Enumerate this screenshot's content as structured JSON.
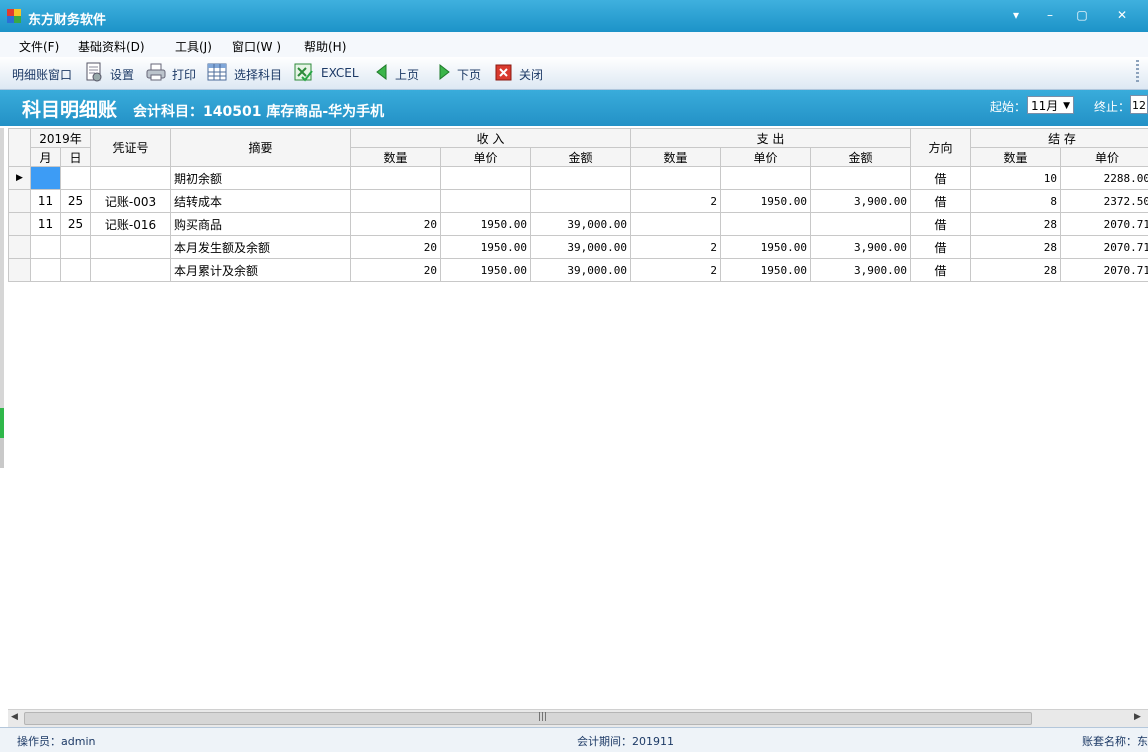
{
  "window": {
    "title": "东方财务软件",
    "controls": [
      "▾",
      "–",
      "▢",
      "✕"
    ]
  },
  "menu": [
    "文件(F)",
    "基础资料(D)",
    "工具(J)",
    "窗口(W )",
    "帮助(H)"
  ],
  "toolbar": {
    "window_label": "明细账窗口",
    "settings": "设置",
    "print": "打印",
    "select_subject": "选择科目",
    "excel": "EXCEL",
    "prev": "上页",
    "next": "下页",
    "close": "关闭"
  },
  "header": {
    "title": "科目明细账",
    "subject": "会计科目：140501 库存商品-华为手机",
    "start_label": "起始：",
    "start_value": "11月",
    "end_label": "终止：",
    "end_value": "12"
  },
  "grid": {
    "year": "2019年",
    "month": "月",
    "day": "日",
    "voucher": "凭证号",
    "summary": "摘要",
    "income": "收  入",
    "expense": "支  出",
    "direction": "方向",
    "balance": "结  存",
    "qty": "数量",
    "price": "单价",
    "amount": "金额",
    "rows": [
      {
        "month": "",
        "day": "",
        "voucher": "",
        "summary": "期初余额",
        "in_qty": "",
        "in_price": "",
        "in_amt": "",
        "out_qty": "",
        "out_price": "",
        "out_amt": "",
        "dir": "借",
        "bal_qty": "10",
        "bal_price": "2288.00"
      },
      {
        "month": "11",
        "day": "25",
        "voucher": "记账-003",
        "summary": "结转成本",
        "in_qty": "",
        "in_price": "",
        "in_amt": "",
        "out_qty": "2",
        "out_price": "1950.00",
        "out_amt": "3,900.00",
        "dir": "借",
        "bal_qty": "8",
        "bal_price": "2372.50"
      },
      {
        "month": "11",
        "day": "25",
        "voucher": "记账-016",
        "summary": "购买商品",
        "in_qty": "20",
        "in_price": "1950.00",
        "in_amt": "39,000.00",
        "out_qty": "",
        "out_price": "",
        "out_amt": "",
        "dir": "借",
        "bal_qty": "28",
        "bal_price": "2070.71"
      },
      {
        "month": "",
        "day": "",
        "voucher": "",
        "summary": "本月发生额及余额",
        "in_qty": "20",
        "in_price": "1950.00",
        "in_amt": "39,000.00",
        "out_qty": "2",
        "out_price": "1950.00",
        "out_amt": "3,900.00",
        "dir": "借",
        "bal_qty": "28",
        "bal_price": "2070.71"
      },
      {
        "month": "",
        "day": "",
        "voucher": "",
        "summary": "本月累计及余额",
        "in_qty": "20",
        "in_price": "1950.00",
        "in_amt": "39,000.00",
        "out_qty": "2",
        "out_price": "1950.00",
        "out_amt": "3,900.00",
        "dir": "借",
        "bal_qty": "28",
        "bal_price": "2070.71"
      }
    ]
  },
  "status": {
    "operator": "操作员：admin",
    "period": "会计期间：201911",
    "account": "账套名称：东"
  },
  "colors": {
    "title_bar": "#1c93c8",
    "header_band": "#2391c6",
    "selected_cell": "#3d9cf5"
  }
}
